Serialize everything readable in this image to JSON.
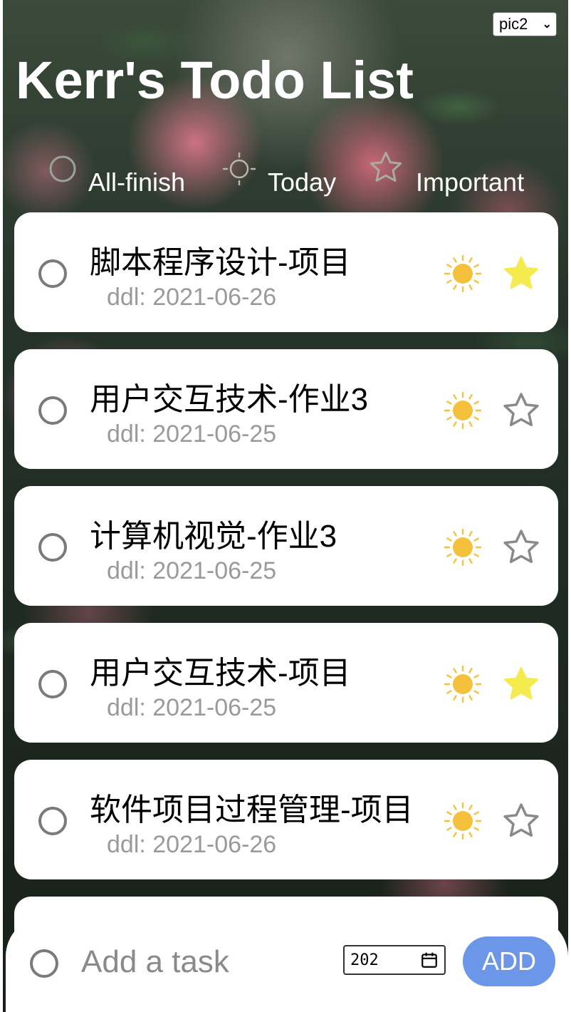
{
  "app": {
    "title": "Kerr's Todo List",
    "theme_select": {
      "value": "pic2"
    }
  },
  "filters": [
    {
      "label": "All-finish",
      "icon": "circle-icon"
    },
    {
      "label": "Today",
      "icon": "sun-icon"
    },
    {
      "label": "Important",
      "icon": "star-outline-icon"
    }
  ],
  "tasks": [
    {
      "name": "脚本程序设计-项目",
      "ddl": "ddl: 2021-06-26",
      "today": true,
      "important": true
    },
    {
      "name": "用户交互技术-作业3",
      "ddl": "ddl: 2021-06-25",
      "today": true,
      "important": false
    },
    {
      "name": "计算机视觉-作业3",
      "ddl": "ddl: 2021-06-25",
      "today": true,
      "important": false
    },
    {
      "name": "用户交互技术-项目",
      "ddl": "ddl: 2021-06-25",
      "today": true,
      "important": true
    },
    {
      "name": "软件项目过程管理-项目",
      "ddl": "ddl: 2021-06-26",
      "today": true,
      "important": false
    }
  ],
  "add_task": {
    "placeholder": "Add a task",
    "date_value": "202",
    "button_label": "ADD"
  },
  "colors": {
    "sun": "#f4c13c",
    "star_active": "#f5ea4e",
    "star_inactive": "#8a8a8a",
    "add_button": "#6c97e8"
  }
}
